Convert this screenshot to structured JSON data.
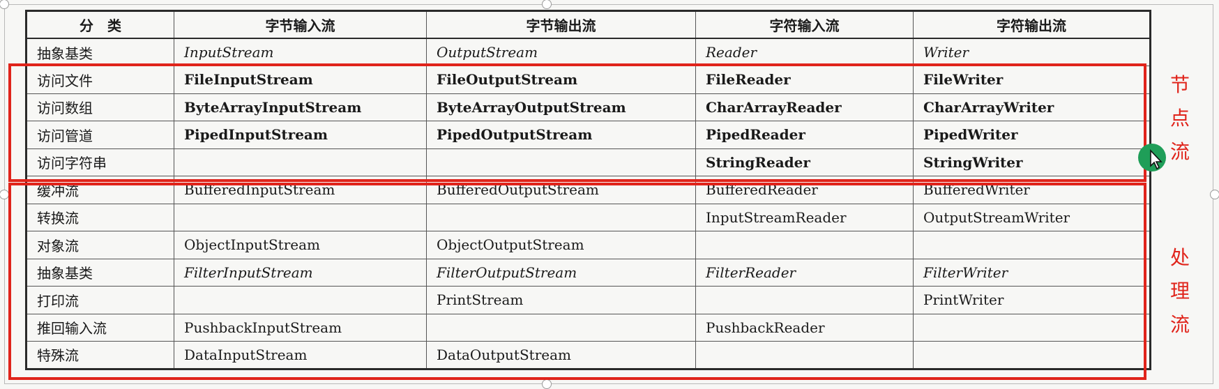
{
  "table": {
    "headers": [
      "分　类",
      "字节输入流",
      "字节输出流",
      "字符输入流",
      "字符输出流"
    ],
    "rows": [
      {
        "category": "抽象基类",
        "cells": [
          "InputStream",
          "OutputStream",
          "Reader",
          "Writer"
        ],
        "style": "italic"
      },
      {
        "category": "访问文件",
        "cells": [
          "FileInputStream",
          "FileOutputStream",
          "FileReader",
          "FileWriter"
        ],
        "style": "bold"
      },
      {
        "category": "访问数组",
        "cells": [
          "ByteArrayInputStream",
          "ByteArrayOutputStream",
          "CharArrayReader",
          "CharArrayWriter"
        ],
        "style": "bold"
      },
      {
        "category": "访问管道",
        "cells": [
          "PipedInputStream",
          "PipedOutputStream",
          "PipedReader",
          "PipedWriter"
        ],
        "style": "bold"
      },
      {
        "category": "访问字符串",
        "cells": [
          "",
          "",
          "StringReader",
          "StringWriter"
        ],
        "style": "bold"
      },
      {
        "category": "缓冲流",
        "cells": [
          "BufferedInputStream",
          "BufferedOutputStream",
          "BufferedReader",
          "BufferedWriter"
        ],
        "style": "normal"
      },
      {
        "category": "转换流",
        "cells": [
          "",
          "",
          "InputStreamReader",
          "OutputStreamWriter"
        ],
        "style": "normal"
      },
      {
        "category": "对象流",
        "cells": [
          "ObjectInputStream",
          "ObjectOutputStream",
          "",
          ""
        ],
        "style": "normal"
      },
      {
        "category": "抽象基类",
        "cells": [
          "FilterInputStream",
          "FilterOutputStream",
          "FilterReader",
          "FilterWriter"
        ],
        "style": "italic"
      },
      {
        "category": "打印流",
        "cells": [
          "",
          "PrintStream",
          "",
          "PrintWriter"
        ],
        "style": "normal"
      },
      {
        "category": "推回输入流",
        "cells": [
          "PushbackInputStream",
          "",
          "PushbackReader",
          ""
        ],
        "style": "normal"
      },
      {
        "category": "特殊流",
        "cells": [
          "DataInputStream",
          "DataOutputStream",
          "",
          ""
        ],
        "style": "normal"
      }
    ]
  },
  "annotations": {
    "node_stream_label": "节\n点\n流",
    "processing_stream_label": "处\n理\n流",
    "color": "#e0241b"
  },
  "cursor": {
    "icon": "move-cursor-icon",
    "color": "#1f9e58"
  }
}
